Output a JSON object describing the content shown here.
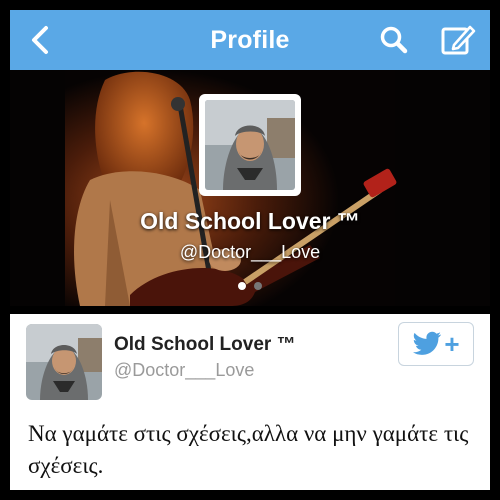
{
  "colors": {
    "accent": "#5aa8e6",
    "button_icon": "#4ea0e0",
    "handle_gray": "#9a9a9a"
  },
  "navbar": {
    "title": "Profile",
    "icons": {
      "back": "chevron-left-icon",
      "search": "search-icon",
      "compose": "compose-icon"
    }
  },
  "header": {
    "name": "Old School Lover ™",
    "handle": "@Doctor___Love",
    "pages": {
      "count": 2,
      "active": 1
    }
  },
  "tweet_card": {
    "name": "Old School Lover ™",
    "handle": "@Doctor___Love",
    "follow_icon": "twitter-bird-icon",
    "follow_symbol": "+",
    "text": "Να γαμάτε στις σχέσεις,αλλα να μην γαμάτε τις σχέσεις."
  }
}
